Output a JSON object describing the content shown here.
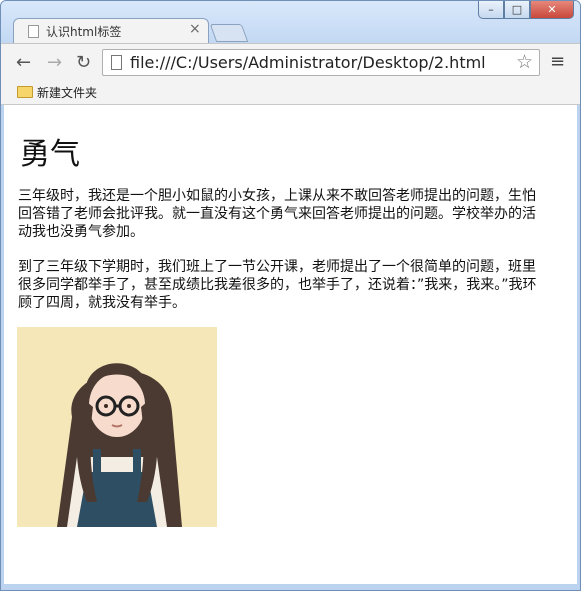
{
  "tab": {
    "title": "认识html标签",
    "close_glyph": "×"
  },
  "window": {
    "minimize": "–",
    "maximize": "□",
    "close": "✕"
  },
  "toolbar": {
    "back": "←",
    "forward": "→",
    "reload": "↻",
    "url": "file:///C:/Users/Administrator/Desktop/2.html",
    "star": "☆",
    "menu": "≡"
  },
  "bookmarks": {
    "items": [
      "新建文件夹"
    ]
  },
  "page": {
    "heading": "勇气",
    "paragraphs": [
      "三年级时，我还是一个胆小如鼠的小女孩，上课从来不敢回答老师提出的问题，生怕回答错了老师会批评我。就一直没有这个勇气来回答老师提出的问题。学校举办的活动我也没勇气参加。",
      "到了三年级下学期时，我们班上了一节公开课，老师提出了一个很简单的问题，班里很多同学都举手了，甚至成绩比我差很多的，也举手了，还说着：”我来，我来。”我环顾了四周，就我没有举手。"
    ],
    "image_name": "girl-illustration"
  }
}
